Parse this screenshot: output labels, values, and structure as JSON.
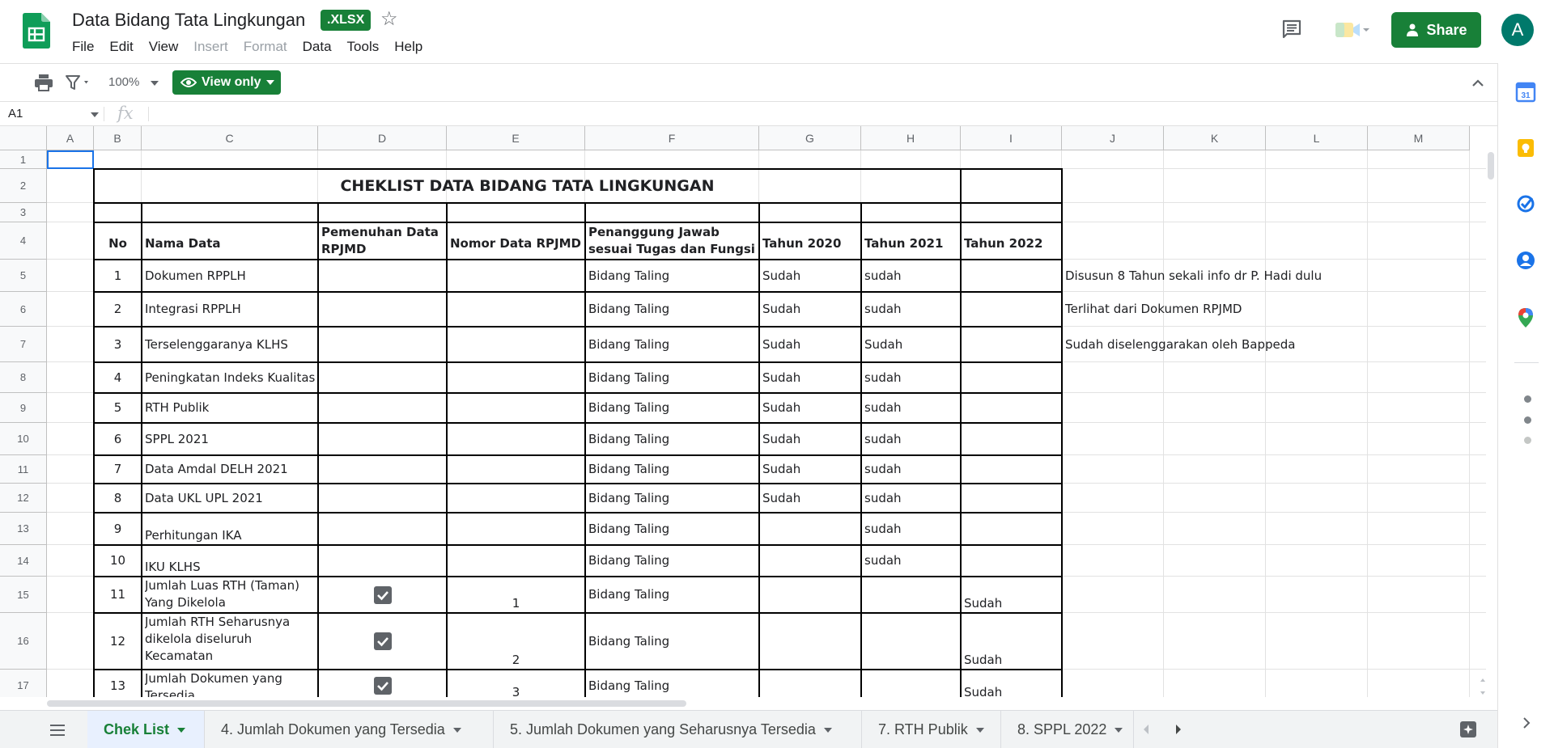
{
  "app": {
    "title": "Data Bidang Tata Lingkungan",
    "file_badge": ".XLSX",
    "menu": [
      "File",
      "Edit",
      "View",
      "Insert",
      "Format",
      "Data",
      "Tools",
      "Help"
    ],
    "menu_disabled": [
      "Insert",
      "Format"
    ],
    "share_label": "Share",
    "avatar_letter": "A",
    "brand_color": "#188038"
  },
  "toolbar": {
    "zoom": "100%",
    "view_only_label": "View only"
  },
  "formula_bar": {
    "cell_ref": "A1",
    "fx": "fx"
  },
  "sheet": {
    "column_headers": [
      "A",
      "B",
      "C",
      "D",
      "E",
      "F",
      "G",
      "H",
      "I",
      "J",
      "K",
      "L",
      "M"
    ],
    "row_headers": [
      "1",
      "2",
      "3",
      "4",
      "5",
      "6",
      "7",
      "8",
      "9",
      "10",
      "11",
      "12",
      "13",
      "14",
      "15",
      "16",
      "17"
    ],
    "title": "CHEKLIST DATA BIDANG TATA LINGKUNGAN",
    "headers": {
      "no": "No",
      "nama": "Nama Data",
      "pemenuhan": "Pemenuhan Data RPJMD",
      "nomor": "Nomor Data RPJMD",
      "pj": "Penanggung Jawab sesuai Tugas dan Fungsi",
      "t2020": "Tahun 2020",
      "t2021": "Tahun 2021",
      "t2022": "Tahun 2022"
    },
    "rows": [
      {
        "no": "1",
        "nama": "Dokumen RPPLH",
        "pemenuhan": false,
        "nomor": "",
        "pj": "Bidang Taling",
        "t2020": "Sudah",
        "t2021": "sudah",
        "t2022": "",
        "note": "Disusun 8 Tahun sekali info dr P. Hadi dulu"
      },
      {
        "no": "2",
        "nama": "Integrasi RPPLH",
        "pemenuhan": false,
        "nomor": "",
        "pj": "Bidang Taling",
        "t2020": "Sudah",
        "t2021": "sudah",
        "t2022": "",
        "note": "Terlihat dari Dokumen RPJMD"
      },
      {
        "no": "3",
        "nama": "Terselenggaranya KLHS",
        "pemenuhan": false,
        "nomor": "",
        "pj": "Bidang Taling",
        "t2020": "Sudah",
        "t2021": "Sudah",
        "t2022": "",
        "note": "Sudah diselenggarakan oleh Bappeda"
      },
      {
        "no": "4",
        "nama": "Peningkatan Indeks Kualitas",
        "pemenuhan": false,
        "nomor": "",
        "pj": "Bidang Taling",
        "t2020": "Sudah",
        "t2021": "sudah",
        "t2022": "",
        "note": ""
      },
      {
        "no": "5",
        "nama": "RTH Publik",
        "pemenuhan": false,
        "nomor": "",
        "pj": "Bidang Taling",
        "t2020": "Sudah",
        "t2021": "sudah",
        "t2022": "",
        "note": ""
      },
      {
        "no": "6",
        "nama": "SPPL 2021",
        "pemenuhan": false,
        "nomor": "",
        "pj": "Bidang Taling",
        "t2020": "Sudah",
        "t2021": "sudah",
        "t2022": "",
        "note": ""
      },
      {
        "no": "7",
        "nama": "Data Amdal DELH 2021",
        "pemenuhan": false,
        "nomor": "",
        "pj": "Bidang Taling",
        "t2020": "Sudah",
        "t2021": "sudah",
        "t2022": "",
        "note": ""
      },
      {
        "no": "8",
        "nama": "Data UKL UPL 2021",
        "pemenuhan": false,
        "nomor": "",
        "pj": "Bidang Taling",
        "t2020": "Sudah",
        "t2021": "sudah",
        "t2022": "",
        "note": ""
      },
      {
        "no": "9",
        "nama": "Perhitungan IKA",
        "pemenuhan": false,
        "nomor": "",
        "pj": "Bidang Taling",
        "t2020": "",
        "t2021": "sudah",
        "t2022": "",
        "note": ""
      },
      {
        "no": "10",
        "nama": "IKU KLHS",
        "pemenuhan": false,
        "nomor": "",
        "pj": "Bidang Taling",
        "t2020": "",
        "t2021": "sudah",
        "t2022": "",
        "note": ""
      },
      {
        "no": "11",
        "nama": "Jumlah Luas RTH (Taman) Yang Dikelola",
        "pemenuhan": true,
        "nomor": "1",
        "pj": "Bidang Taling",
        "t2020": "",
        "t2021": "",
        "t2022": "Sudah",
        "note": ""
      },
      {
        "no": "12",
        "nama": "Jumlah RTH Seharusnya dikelola diseluruh Kecamatan",
        "pemenuhan": true,
        "nomor": "2",
        "pj": "Bidang Taling",
        "t2020": "",
        "t2021": "",
        "t2022": "Sudah",
        "note": ""
      },
      {
        "no": "13",
        "nama": "Jumlah Dokumen yang Tersedia",
        "pemenuhan": true,
        "nomor": "3",
        "pj": "Bidang Taling",
        "t2020": "",
        "t2021": "",
        "t2022": "Sudah",
        "note": ""
      }
    ]
  },
  "tabs": [
    {
      "label": "Chek List",
      "active": true
    },
    {
      "label": "4. Jumlah Dokumen yang Tersedia",
      "active": false
    },
    {
      "label": "5. Jumlah Dokumen yang Seharusnya Tersedia",
      "active": false
    },
    {
      "label": "7. RTH Publik",
      "active": false
    },
    {
      "label": "8. SPPL 2022",
      "active": false
    }
  ],
  "side_panel": {
    "icons": [
      "calendar-icon",
      "keep-icon",
      "tasks-icon",
      "contacts-icon",
      "maps-icon"
    ],
    "calendar_day": "31"
  }
}
